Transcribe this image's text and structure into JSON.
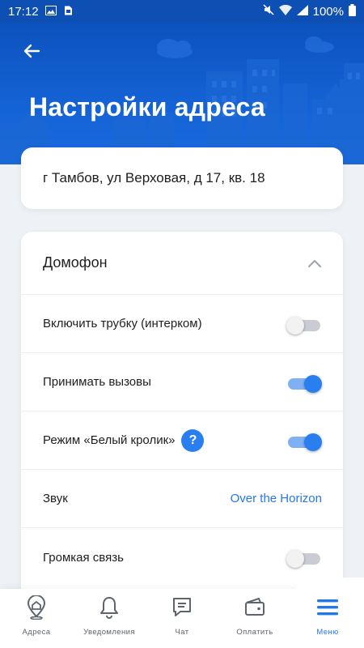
{
  "status_bar": {
    "time": "17:12",
    "battery": "100%",
    "icons": [
      "image-icon",
      "sim-icon",
      "mute-icon",
      "wifi-icon",
      "signal-icon",
      "battery-icon"
    ]
  },
  "header": {
    "title": "Настройки адреса",
    "back_icon": "arrow-left-icon"
  },
  "address": {
    "text": "г Тамбов, ул Верховая, д 17, кв. 18"
  },
  "intercom": {
    "title": "Домофон",
    "expanded": true,
    "rows": [
      {
        "label": "Включить трубку (интерком)",
        "type": "toggle",
        "on": false
      },
      {
        "label": "Принимать вызовы",
        "type": "toggle",
        "on": true
      },
      {
        "label": "Режим «Белый кролик»",
        "type": "toggle",
        "on": true,
        "help": "?"
      },
      {
        "label": "Звук",
        "type": "value",
        "value": "Over the Horizon"
      },
      {
        "label": "Громкая связь",
        "type": "toggle",
        "on": false
      }
    ]
  },
  "tabs": [
    {
      "label": "Адреса",
      "icon": "location-pin-icon",
      "active": false
    },
    {
      "label": "Уведомления",
      "icon": "bell-icon",
      "active": false
    },
    {
      "label": "Чат",
      "icon": "chat-icon",
      "active": false
    },
    {
      "label": "Оплатить",
      "icon": "wallet-icon",
      "active": false
    },
    {
      "label": "Меню",
      "icon": "menu-icon",
      "active": true
    }
  ],
  "colors": {
    "header_blue": "#1463d6",
    "accent": "#2a7ff0",
    "link": "#2478e6",
    "background": "#eef1f6"
  }
}
